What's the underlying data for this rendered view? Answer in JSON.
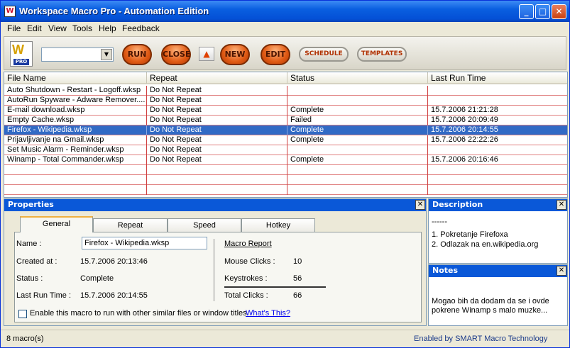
{
  "window": {
    "title": "Workspace Macro Pro - Automation Edition"
  },
  "menu": [
    "File",
    "Edit",
    "View",
    "Tools",
    "Help",
    "Feedback"
  ],
  "toolbar": {
    "logo_text": "PRO",
    "combo_value": "",
    "run_label": "RUN",
    "close_label": "CLOSE",
    "new_label": "NEW",
    "edit_label": "EDIT",
    "schedule_label": "SCHEDULE",
    "templates_label": "TEMPLATES"
  },
  "table": {
    "columns": [
      "File Name",
      "Repeat",
      "Status",
      "Last Run Time"
    ],
    "rows": [
      [
        "Auto Shutdown - Restart - Logoff.wksp",
        "Do Not Repeat",
        "",
        ""
      ],
      [
        "AutoRun Spyware - Adware Remover....",
        "Do Not Repeat",
        "",
        ""
      ],
      [
        "E-mail download.wksp",
        "Do Not Repeat",
        "Complete",
        "15.7.2006 21:21:28"
      ],
      [
        "Empty Cache.wksp",
        "Do Not Repeat",
        "Failed",
        "15.7.2006 20:09:49"
      ],
      [
        "Firefox - Wikipedia.wksp",
        "Do Not Repeat",
        "Complete",
        "15.7.2006 20:14:55"
      ],
      [
        "Prijavljivanje na Gmail.wksp",
        "Do Not Repeat",
        "Complete",
        "15.7.2006 22:22:26"
      ],
      [
        "Set Music Alarm - Reminder.wksp",
        "Do Not Repeat",
        "",
        ""
      ],
      [
        "Winamp - Total Commander.wksp",
        "Do Not Repeat",
        "Complete",
        "15.7.2006 20:16:46"
      ]
    ],
    "selected_index": 4
  },
  "properties": {
    "title": "Properties",
    "tabs": [
      "General",
      "Repeat",
      "Speed",
      "Hotkey"
    ],
    "name_label": "Name :",
    "name_value": "Firefox - Wikipedia.wksp",
    "created_label": "Created at :",
    "created_value": "15.7.2006 20:13:46",
    "status_label": "Status :",
    "status_value": "Complete",
    "lastrun_label": "Last Run Time :",
    "lastrun_value": "15.7.2006 20:14:55",
    "report_title": "Macro Report",
    "mouse_label": "Mouse Clicks :",
    "mouse_value": "10",
    "keys_label": "Keystrokes :",
    "keys_value": "56",
    "total_label": "Total Clicks :",
    "total_value": "66",
    "checkbox_label": "Enable this macro to run with other similar files or window titles",
    "whats_this": "What's This?"
  },
  "description": {
    "title": "Description",
    "lines": [
      "------",
      "1. Pokretanje Firefoxa",
      "2. Odlazak na en.wikipedia.org"
    ]
  },
  "notes": {
    "title": "Notes",
    "lines": [
      "Mogao bih da dodam da se i ovde",
      "pokrene Winamp s malo muzke..."
    ]
  },
  "statusbar": {
    "left": "8 macro(s)",
    "right": "Enabled by SMART Macro Technology"
  },
  "colors": {
    "titlebar": "#0a5fe0",
    "selection": "#316ac5",
    "orange_button": "#e05a14",
    "grid_line": "#e08080"
  }
}
